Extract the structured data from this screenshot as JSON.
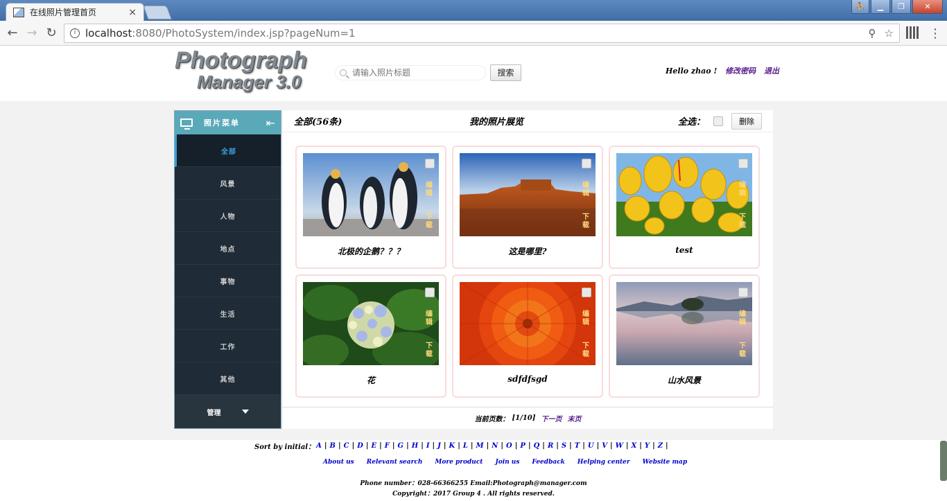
{
  "browser": {
    "tab_title": "在线照片管理首页",
    "tab_close": "×",
    "url_host": "localhost",
    "url_rest": ":8080/PhotoSystem/index.jsp?pageNum=1",
    "back": "←",
    "forward": "→",
    "reload": "↻",
    "info": "i",
    "zoom": "⚲",
    "star": "☆",
    "menu": "⋮",
    "win_user": "⛹",
    "win_min": "▁",
    "win_max": "❐",
    "win_close": "✕"
  },
  "header": {
    "logo_line1": "Photograph",
    "logo_line2": "Manager 3.0",
    "search_placeholder": "请输入照片标题",
    "search_button": "搜索",
    "hello": "Hello zhao !",
    "change_password": "修改密码",
    "logout": "退出"
  },
  "sidebar": {
    "title": "照片菜单",
    "collapse_icon": "⇤",
    "items": [
      {
        "label": "全部"
      },
      {
        "label": "风景"
      },
      {
        "label": "人物"
      },
      {
        "label": "地点"
      },
      {
        "label": "事物"
      },
      {
        "label": "生活"
      },
      {
        "label": "工作"
      },
      {
        "label": "其他"
      }
    ],
    "manage": "管理"
  },
  "main": {
    "count": "全部(56条)",
    "title": "我的照片展览",
    "select_all": "全选：",
    "delete_button": "删除",
    "edit_label": "编辑",
    "download_label": "下载",
    "photos": [
      {
        "caption": "北极的企鹅？？？",
        "scene": "penguins"
      },
      {
        "caption": "这是哪里?",
        "scene": "desert"
      },
      {
        "caption": "test",
        "scene": "tulips"
      },
      {
        "caption": "花",
        "scene": "hydrangea"
      },
      {
        "caption": "sdfdfsgd",
        "scene": "chrysanthemum"
      },
      {
        "caption": "山水风景",
        "scene": "lake"
      }
    ],
    "pager_label": "当前页数：",
    "pager_value": "[1/10]",
    "next_page": "下一页",
    "last_page": "末页"
  },
  "footer": {
    "sort_label": "Sort by initial：",
    "letters": [
      "A",
      "B",
      "C",
      "D",
      "E",
      "F",
      "G",
      "H",
      "I",
      "J",
      "K",
      "L",
      "M",
      "N",
      "O",
      "P",
      "Q",
      "R",
      "S",
      "T",
      "U",
      "V",
      "W",
      "X",
      "Y",
      "Z"
    ],
    "links": [
      "About us",
      "Relevant search",
      "More product",
      "Join us",
      "Feedback",
      "Helping center",
      "Website map"
    ],
    "contact": "Phone number：028-66366255 Email:Photograph@manager.com",
    "copyright": "Copyright：2017 Group 4 . All rights reserved."
  }
}
